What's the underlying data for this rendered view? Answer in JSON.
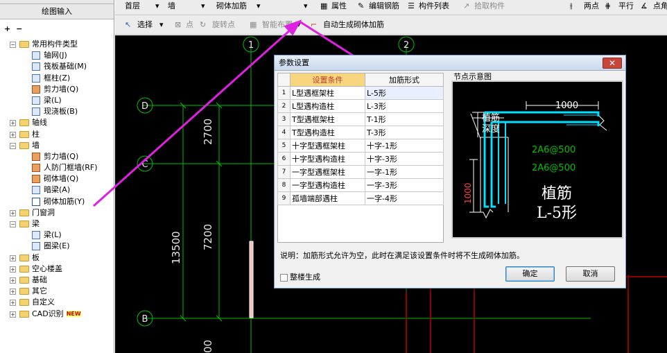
{
  "sidebar": {
    "header": "绘图输入",
    "tools": [
      "+",
      "−"
    ],
    "tree": [
      {
        "label": "常用构件类型",
        "level": 0,
        "type": "folder",
        "expand": "−"
      },
      {
        "label": "轴网(J)",
        "level": 1,
        "type": "item"
      },
      {
        "label": "筏板基础(M)",
        "level": 1,
        "type": "item"
      },
      {
        "label": "框柱(Z)",
        "level": 1,
        "type": "item"
      },
      {
        "label": "剪力墙(Q)",
        "level": 1,
        "type": "brick"
      },
      {
        "label": "梁(L)",
        "level": 1,
        "type": "item"
      },
      {
        "label": "现浇板(B)",
        "level": 1,
        "type": "item"
      },
      {
        "label": "轴线",
        "level": 0,
        "type": "folder",
        "expand": "+"
      },
      {
        "label": "柱",
        "level": 0,
        "type": "folder",
        "expand": "+"
      },
      {
        "label": "墙",
        "level": 0,
        "type": "folder",
        "expand": "−"
      },
      {
        "label": "剪力墙(Q)",
        "level": 1,
        "type": "brick"
      },
      {
        "label": "人防门框墙(RF)",
        "level": 1,
        "type": "brick"
      },
      {
        "label": "砌体墙(Q)",
        "level": 1,
        "type": "brick"
      },
      {
        "label": "暗梁(A)",
        "level": 1,
        "type": "item"
      },
      {
        "label": "砌体加筋(Y)",
        "level": 1,
        "type": "sel"
      },
      {
        "label": "门窗洞",
        "level": 0,
        "type": "folder",
        "expand": "+"
      },
      {
        "label": "梁",
        "level": 0,
        "type": "folder",
        "expand": "−"
      },
      {
        "label": "梁(L)",
        "level": 1,
        "type": "item"
      },
      {
        "label": "圈梁(E)",
        "level": 1,
        "type": "item"
      },
      {
        "label": "板",
        "level": 0,
        "type": "folder",
        "expand": "+"
      },
      {
        "label": "空心楼盖",
        "level": 0,
        "type": "folder",
        "expand": "+"
      },
      {
        "label": "基础",
        "level": 0,
        "type": "folder",
        "expand": "+"
      },
      {
        "label": "其它",
        "level": 0,
        "type": "folder",
        "expand": "+"
      },
      {
        "label": "自定义",
        "level": 0,
        "type": "folder",
        "expand": "+"
      },
      {
        "label": "CAD识别",
        "level": 0,
        "type": "folder",
        "expand": "+",
        "badge": "NEW"
      }
    ]
  },
  "toolbar1": {
    "floor": "首层",
    "category": "墙",
    "component": "砌体加筋",
    "props": "属性",
    "edit_rebar": "编辑钢筋",
    "comp_list": "构件列表",
    "pick": "拾取构件",
    "two_point": "两点",
    "parallel": "平行",
    "point_angle": "点角"
  },
  "toolbar2": {
    "select": "选择",
    "point": "点",
    "rotate_point": "旋转点",
    "smart_layout": "智能布置",
    "auto_gen": "自动生成砌体加筋"
  },
  "canvas": {
    "axis_top": [
      "1",
      "2"
    ],
    "axis_left": [
      "D",
      "C",
      "B"
    ],
    "dims": [
      "2700",
      "7200",
      "13500",
      "00"
    ]
  },
  "dialog": {
    "title": "参数设置",
    "close": "✕",
    "col_condition": "设置条件",
    "col_form": "加筋形式",
    "rows": [
      {
        "no": "1",
        "condition": "L型遇框架柱",
        "form": "L-5形"
      },
      {
        "no": "2",
        "condition": "L型遇构造柱",
        "form": "L-3形"
      },
      {
        "no": "3",
        "condition": "T型遇框架柱",
        "form": "T-1形"
      },
      {
        "no": "4",
        "condition": "T型遇构造柱",
        "form": "T-3形"
      },
      {
        "no": "5",
        "condition": "十字型遇框架柱",
        "form": "十字-1形"
      },
      {
        "no": "6",
        "condition": "十字型遇构造柱",
        "form": "十字-3形"
      },
      {
        "no": "7",
        "condition": "一字型遇框架柱",
        "form": "一字-1形"
      },
      {
        "no": "8",
        "condition": "一字型遇构造柱",
        "form": "一字-3形"
      },
      {
        "no": "9",
        "condition": "孤墙端部遇柱",
        "form": "一字-4形"
      }
    ],
    "node_title": "节点示意图",
    "node": {
      "dim_top": "1000",
      "embed": "植筋",
      "depth": "深度",
      "rebar1": "2A6@500",
      "rebar2": "2A6@500",
      "dim_left": "1000",
      "big1": "植筋",
      "big2": "L-5形"
    },
    "note": "说明：加筋形式允许为空，此时在满足该设置条件时将不生成砌体加筋。",
    "whole_building": "整楼生成",
    "ok": "确定",
    "cancel": "取消"
  },
  "colors": {
    "accent_red": "#c0392b",
    "cad_green": "#00c000",
    "cad_cyan": "#00e0ff",
    "arrow_magenta": "#e020e0"
  }
}
